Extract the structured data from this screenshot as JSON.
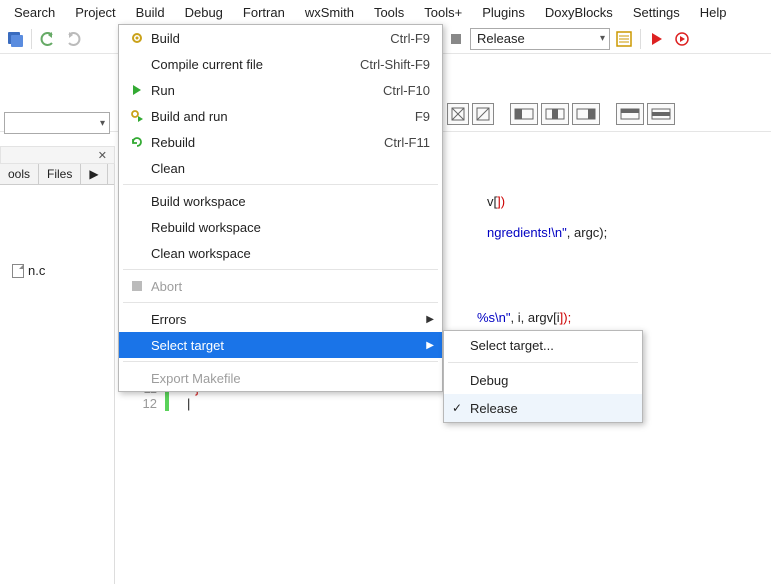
{
  "menubar": [
    "Search",
    "Project",
    "Build",
    "Debug",
    "Fortran",
    "wxSmith",
    "Tools",
    "Tools+",
    "Plugins",
    "DoxyBlocks",
    "Settings",
    "Help"
  ],
  "toolbar": {
    "target_combo": "Release"
  },
  "sidebar": {
    "tabs": [
      "ools",
      "Files",
      "▶"
    ],
    "file": "n.c"
  },
  "build_menu": {
    "items": [
      {
        "icon": "gear",
        "label": "Build",
        "shortcut": "Ctrl-F9"
      },
      {
        "icon": "",
        "label": "Compile current file",
        "shortcut": "Ctrl-Shift-F9"
      },
      {
        "icon": "play",
        "label": "Run",
        "shortcut": "Ctrl-F10"
      },
      {
        "icon": "gearplay",
        "label": "Build and run",
        "shortcut": "F9"
      },
      {
        "icon": "cycle",
        "label": "Rebuild",
        "shortcut": "Ctrl-F11"
      },
      {
        "icon": "",
        "label": "Clean",
        "shortcut": ""
      },
      {
        "divider": true
      },
      {
        "icon": "",
        "label": "Build workspace",
        "shortcut": ""
      },
      {
        "icon": "",
        "label": "Rebuild workspace",
        "shortcut": ""
      },
      {
        "icon": "",
        "label": "Clean workspace",
        "shortcut": ""
      },
      {
        "divider": true
      },
      {
        "icon": "stop",
        "label": "Abort",
        "shortcut": "",
        "disabled": true
      },
      {
        "divider": true
      },
      {
        "icon": "",
        "label": "Errors",
        "shortcut": "",
        "submenu": true
      },
      {
        "icon": "",
        "label": "Select target",
        "shortcut": "",
        "submenu": true,
        "highlight": true
      },
      {
        "divider": true
      },
      {
        "icon": "",
        "label": "Export Makefile",
        "shortcut": "",
        "disabled": true
      }
    ]
  },
  "submenu": {
    "items": [
      {
        "label": "Select target...",
        "check": false
      },
      {
        "divider": true
      },
      {
        "label": "Debug",
        "check": false
      },
      {
        "label": "Release",
        "check": true,
        "hover": true
      }
    ]
  },
  "code": {
    "frag1_a": "v[",
    "frag1_b": "])",
    "frag2_a": "ngredients!\\n\"",
    "frag2_b": ", argc);",
    "frag3_a": "%s\\n\"",
    "frag3_b": ", i, argv[",
    "frag3_c": "i",
    "frag3_d": "]);",
    "line11_num": "11",
    "line11_txt": "}",
    "line12_num": "12",
    "line12_txt": ""
  }
}
